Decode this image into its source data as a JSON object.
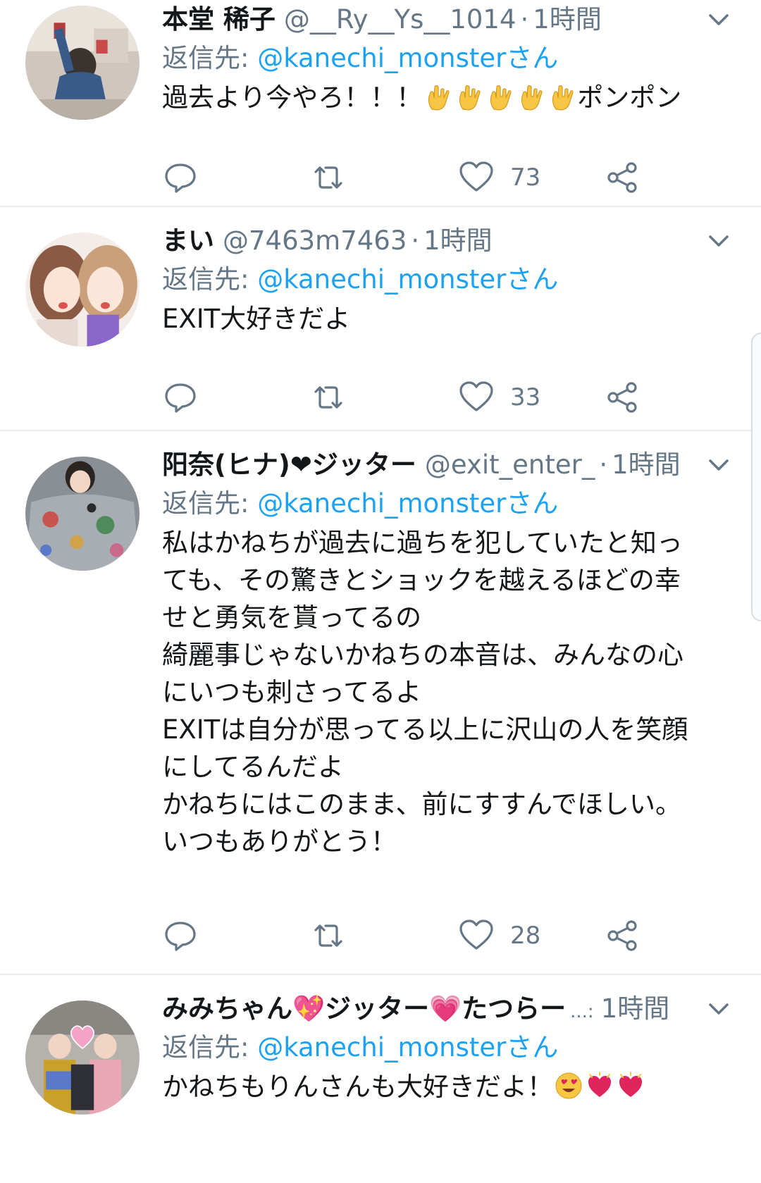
{
  "colors": {
    "link": "#1da1f2",
    "secondary": "#657786",
    "text": "#14171a",
    "divider": "#e6ecf0"
  },
  "tweets": [
    {
      "display_name": "本堂 稀子",
      "handle": "@__Ry__Ys__1014",
      "separator": "·",
      "time": "1時間",
      "reply_prefix": "返信先:",
      "reply_target": "@kanechi_monsterさん",
      "text": "過去より今やろ！！！",
      "text_suffix": "ポンポン",
      "emoji": [
        "love-you-gesture",
        "love-you-gesture",
        "love-you-gesture",
        "love-you-gesture",
        "love-you-gesture"
      ],
      "likes": "73"
    },
    {
      "display_name": "まい",
      "handle": "@7463m7463",
      "separator": "·",
      "time": "1時間",
      "reply_prefix": "返信先:",
      "reply_target": "@kanechi_monsterさん",
      "text": "EXIT大好きだよ",
      "likes": "33"
    },
    {
      "display_name": "阳奈(ヒナ)❤ジッター",
      "handle": "@exit_enter_",
      "separator": "·",
      "time": "1時間",
      "reply_prefix": "返信先:",
      "reply_target": "@kanechi_monsterさん",
      "text": "私はかねちが過去に過ちを犯していたと知っても、その驚きとショックを越えるほどの幸せと勇気を貰ってるの\n綺麗事じゃないかねちの本音は、みんなの心にいつも刺さってるよ\nEXITは自分が思ってる以上に沢山の人を笑顔にしてるんだよ\nかねちにはこのまま、前にすすんでほしい。\nいつもありがとう！",
      "likes": "28"
    },
    {
      "display_name": "みみちゃん💖ジッター💗たつらー",
      "ellipsis": "...:",
      "time": "1時間",
      "reply_prefix": "返信先:",
      "reply_target": "@kanechi_monsterさん",
      "text": "かねちもりんさんも大好きだよ！",
      "emoji": [
        "heart-eyes-face",
        "heart-with-lines",
        "heart-with-lines"
      ]
    }
  ],
  "icons": {
    "reply": "reply-icon",
    "retweet": "retweet-icon",
    "like": "heart-icon",
    "share": "share-icon",
    "menu": "chevron-down-icon"
  }
}
